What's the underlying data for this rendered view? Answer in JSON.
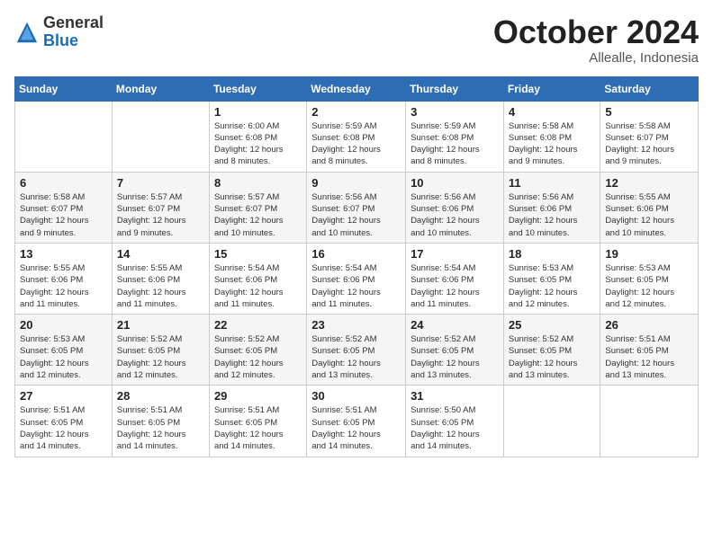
{
  "logo": {
    "general": "General",
    "blue": "Blue"
  },
  "title": "October 2024",
  "location": "Allealle, Indonesia",
  "days_header": [
    "Sunday",
    "Monday",
    "Tuesday",
    "Wednesday",
    "Thursday",
    "Friday",
    "Saturday"
  ],
  "weeks": [
    [
      {
        "day": "",
        "info": ""
      },
      {
        "day": "",
        "info": ""
      },
      {
        "day": "1",
        "info": "Sunrise: 6:00 AM\nSunset: 6:08 PM\nDaylight: 12 hours\nand 8 minutes."
      },
      {
        "day": "2",
        "info": "Sunrise: 5:59 AM\nSunset: 6:08 PM\nDaylight: 12 hours\nand 8 minutes."
      },
      {
        "day": "3",
        "info": "Sunrise: 5:59 AM\nSunset: 6:08 PM\nDaylight: 12 hours\nand 8 minutes."
      },
      {
        "day": "4",
        "info": "Sunrise: 5:58 AM\nSunset: 6:08 PM\nDaylight: 12 hours\nand 9 minutes."
      },
      {
        "day": "5",
        "info": "Sunrise: 5:58 AM\nSunset: 6:07 PM\nDaylight: 12 hours\nand 9 minutes."
      }
    ],
    [
      {
        "day": "6",
        "info": "Sunrise: 5:58 AM\nSunset: 6:07 PM\nDaylight: 12 hours\nand 9 minutes."
      },
      {
        "day": "7",
        "info": "Sunrise: 5:57 AM\nSunset: 6:07 PM\nDaylight: 12 hours\nand 9 minutes."
      },
      {
        "day": "8",
        "info": "Sunrise: 5:57 AM\nSunset: 6:07 PM\nDaylight: 12 hours\nand 10 minutes."
      },
      {
        "day": "9",
        "info": "Sunrise: 5:56 AM\nSunset: 6:07 PM\nDaylight: 12 hours\nand 10 minutes."
      },
      {
        "day": "10",
        "info": "Sunrise: 5:56 AM\nSunset: 6:06 PM\nDaylight: 12 hours\nand 10 minutes."
      },
      {
        "day": "11",
        "info": "Sunrise: 5:56 AM\nSunset: 6:06 PM\nDaylight: 12 hours\nand 10 minutes."
      },
      {
        "day": "12",
        "info": "Sunrise: 5:55 AM\nSunset: 6:06 PM\nDaylight: 12 hours\nand 10 minutes."
      }
    ],
    [
      {
        "day": "13",
        "info": "Sunrise: 5:55 AM\nSunset: 6:06 PM\nDaylight: 12 hours\nand 11 minutes."
      },
      {
        "day": "14",
        "info": "Sunrise: 5:55 AM\nSunset: 6:06 PM\nDaylight: 12 hours\nand 11 minutes."
      },
      {
        "day": "15",
        "info": "Sunrise: 5:54 AM\nSunset: 6:06 PM\nDaylight: 12 hours\nand 11 minutes."
      },
      {
        "day": "16",
        "info": "Sunrise: 5:54 AM\nSunset: 6:06 PM\nDaylight: 12 hours\nand 11 minutes."
      },
      {
        "day": "17",
        "info": "Sunrise: 5:54 AM\nSunset: 6:06 PM\nDaylight: 12 hours\nand 11 minutes."
      },
      {
        "day": "18",
        "info": "Sunrise: 5:53 AM\nSunset: 6:05 PM\nDaylight: 12 hours\nand 12 minutes."
      },
      {
        "day": "19",
        "info": "Sunrise: 5:53 AM\nSunset: 6:05 PM\nDaylight: 12 hours\nand 12 minutes."
      }
    ],
    [
      {
        "day": "20",
        "info": "Sunrise: 5:53 AM\nSunset: 6:05 PM\nDaylight: 12 hours\nand 12 minutes."
      },
      {
        "day": "21",
        "info": "Sunrise: 5:52 AM\nSunset: 6:05 PM\nDaylight: 12 hours\nand 12 minutes."
      },
      {
        "day": "22",
        "info": "Sunrise: 5:52 AM\nSunset: 6:05 PM\nDaylight: 12 hours\nand 12 minutes."
      },
      {
        "day": "23",
        "info": "Sunrise: 5:52 AM\nSunset: 6:05 PM\nDaylight: 12 hours\nand 13 minutes."
      },
      {
        "day": "24",
        "info": "Sunrise: 5:52 AM\nSunset: 6:05 PM\nDaylight: 12 hours\nand 13 minutes."
      },
      {
        "day": "25",
        "info": "Sunrise: 5:52 AM\nSunset: 6:05 PM\nDaylight: 12 hours\nand 13 minutes."
      },
      {
        "day": "26",
        "info": "Sunrise: 5:51 AM\nSunset: 6:05 PM\nDaylight: 12 hours\nand 13 minutes."
      }
    ],
    [
      {
        "day": "27",
        "info": "Sunrise: 5:51 AM\nSunset: 6:05 PM\nDaylight: 12 hours\nand 14 minutes."
      },
      {
        "day": "28",
        "info": "Sunrise: 5:51 AM\nSunset: 6:05 PM\nDaylight: 12 hours\nand 14 minutes."
      },
      {
        "day": "29",
        "info": "Sunrise: 5:51 AM\nSunset: 6:05 PM\nDaylight: 12 hours\nand 14 minutes."
      },
      {
        "day": "30",
        "info": "Sunrise: 5:51 AM\nSunset: 6:05 PM\nDaylight: 12 hours\nand 14 minutes."
      },
      {
        "day": "31",
        "info": "Sunrise: 5:50 AM\nSunset: 6:05 PM\nDaylight: 12 hours\nand 14 minutes."
      },
      {
        "day": "",
        "info": ""
      },
      {
        "day": "",
        "info": ""
      }
    ]
  ]
}
